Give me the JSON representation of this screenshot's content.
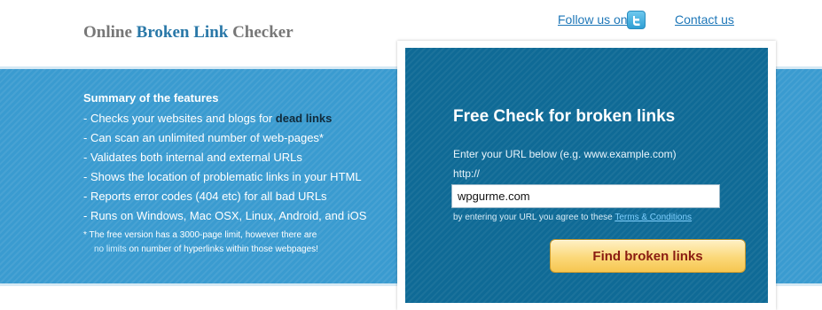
{
  "header": {
    "logo": {
      "word1": "Online",
      "word2": "Broken Link",
      "word3": "Checker"
    },
    "nav": {
      "follow_label": "Follow us on",
      "twitter_icon": "twitter-bird-icon",
      "contact_label": "Contact us"
    }
  },
  "features": {
    "title": "Summary of the features",
    "items": [
      {
        "text": "- Checks your websites and blogs for ",
        "bold": "dead links"
      },
      {
        "text": "- Can scan an unlimited number of web-pages*",
        "bold": ""
      },
      {
        "text": "- Validates both internal and external URLs",
        "bold": ""
      },
      {
        "text": "- Shows the location of problematic links in your HTML",
        "bold": ""
      },
      {
        "text": "- Reports error codes (404 etc) for all bad URLs",
        "bold": ""
      },
      {
        "text": "- Runs on Windows, Mac OSX, Linux, Android, and iOS",
        "bold": ""
      }
    ],
    "note": {
      "line1": "* The free version has a 3000-page limit, however there are",
      "highlight": "no limits",
      "line2_rest": " on number of hyperlinks within those webpages!"
    }
  },
  "check": {
    "title": "Free Check for broken links",
    "help": "Enter your URL below (e.g. www.example.com)",
    "prefix": "http://",
    "input_value": "wpgurme.com",
    "terms_text": "by entering your URL you agree to these ",
    "terms_link": "Terms & Conditions",
    "button_label": "Find broken links"
  },
  "colors": {
    "band": "#3a9bd0",
    "panel": "#0f6a96",
    "logo_accent": "#2a78a8",
    "button": "#fbd879",
    "button_text": "#8a1c12"
  }
}
